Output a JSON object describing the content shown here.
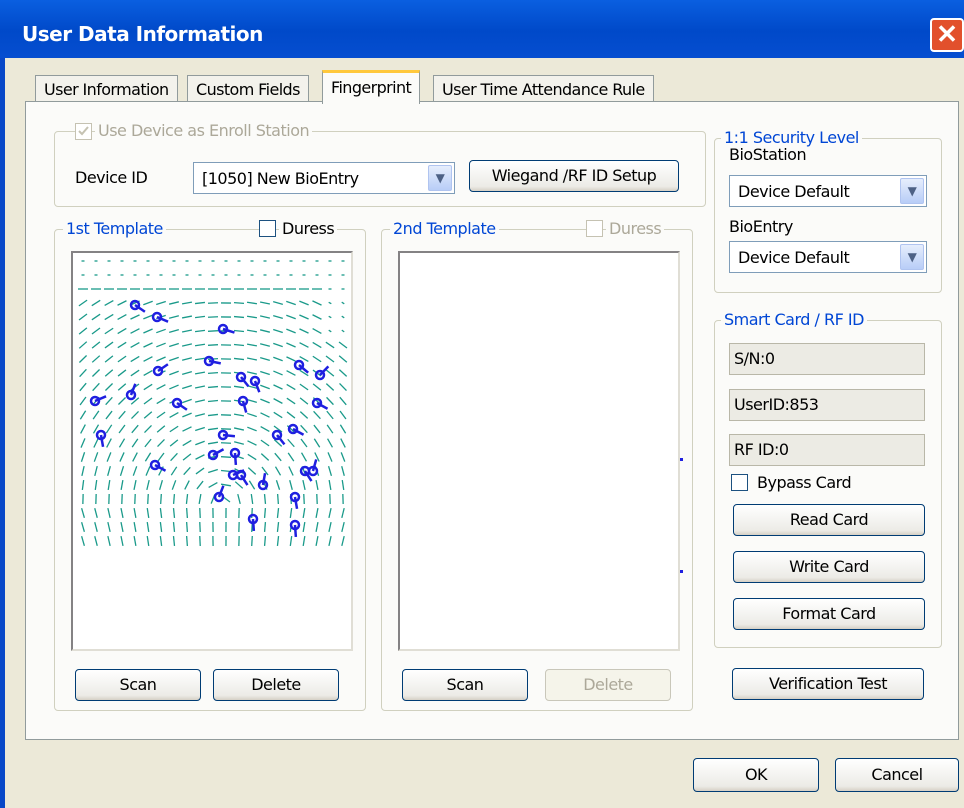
{
  "window": {
    "title": "User Data Information",
    "close_glyph": "✕"
  },
  "tabs": [
    {
      "label": "User Information"
    },
    {
      "label": "Custom Fields"
    },
    {
      "label": "Fingerprint"
    },
    {
      "label": "User Time Attendance Rule"
    }
  ],
  "enroll": {
    "checkbox_label": "Use Device as Enroll Station",
    "checked": true,
    "device_id_label": "Device ID",
    "device_id_value": "[1050] New BioEntry",
    "wiegand_button": "Wiegand /RF ID Setup"
  },
  "template1": {
    "title": "1st Template",
    "duress_label": "Duress",
    "scan_button": "Scan",
    "delete_button": "Delete"
  },
  "template2": {
    "title": "2nd Template",
    "duress_label": "Duress",
    "scan_button": "Scan",
    "delete_button": "Delete"
  },
  "security": {
    "title": "1:1 Security Level",
    "biostation_label": "BioStation",
    "biostation_value": "Device Default",
    "bioentry_label": "BioEntry",
    "bioentry_value": "Device Default"
  },
  "smartcard": {
    "title": "Smart Card / RF ID",
    "sn": "S/N:0",
    "userid": "UserID:853",
    "rfid": "RF ID:0",
    "bypass_label": "Bypass Card",
    "read_button": "Read Card",
    "write_button": "Write Card",
    "format_button": "Format Card"
  },
  "verification_button": "Verification Test",
  "footer": {
    "ok_button": "OK",
    "cancel_button": "Cancel"
  },
  "colors": {
    "title_bar": "#0054e3",
    "accent_text": "#0046d5",
    "minutiae": "#1f1fe0",
    "ridge": "#1a9a8a"
  }
}
